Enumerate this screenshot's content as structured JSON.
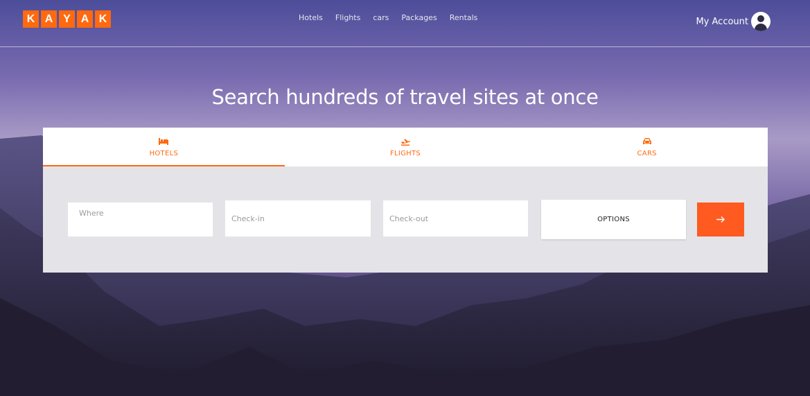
{
  "brand": {
    "logo_letters": [
      "K",
      "A",
      "Y",
      "A",
      "K"
    ],
    "accent_color": "#ff690f"
  },
  "nav": {
    "items": [
      "Hotels",
      "Flights",
      "cars",
      "Packages",
      "Rentals"
    ]
  },
  "account": {
    "label": "My Account",
    "icon": "user-avatar-icon"
  },
  "hero": {
    "headline": "Search hundreds of travel sites at once"
  },
  "search": {
    "tabs": [
      {
        "label": "HOTELS",
        "icon": "bed-icon",
        "active": true
      },
      {
        "label": "FLIGHTS",
        "icon": "plane-takeoff-icon",
        "active": false
      },
      {
        "label": "CARS",
        "icon": "car-icon",
        "active": false
      }
    ],
    "where_placeholder": "Where",
    "checkin_placeholder": "Check-in",
    "checkout_placeholder": "Check-out",
    "options_label": "OPTIONS",
    "submit_icon": "arrow-right-icon",
    "submit_color": "#ff5a1f"
  }
}
